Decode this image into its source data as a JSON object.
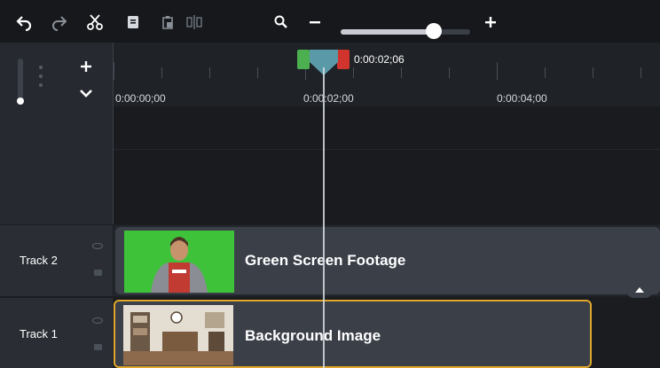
{
  "timeline": {
    "playhead_time": "0:00:02;06",
    "ruler_labels": [
      "0:00:00;00",
      "0:00:02;00",
      "0:00:04;00"
    ]
  },
  "toolbar": {
    "buttons": [
      "undo-icon",
      "redo-icon",
      "cut-icon",
      "copy-icon",
      "paste-icon",
      "split-icon",
      "search-icon",
      "zoom-out-icon",
      "zoom-in-icon"
    ],
    "zoom_level": 0.72
  },
  "tracks": [
    {
      "name": "Track 2",
      "clip_title": "Green Screen Footage",
      "selected": false
    },
    {
      "name": "Track 1",
      "clip_title": "Background Image",
      "selected": true
    }
  ],
  "colors": {
    "selection": "#e0a72c",
    "in_point": "#4caf50",
    "out_point": "#d0342c",
    "playhead": "#5a9aa8"
  }
}
